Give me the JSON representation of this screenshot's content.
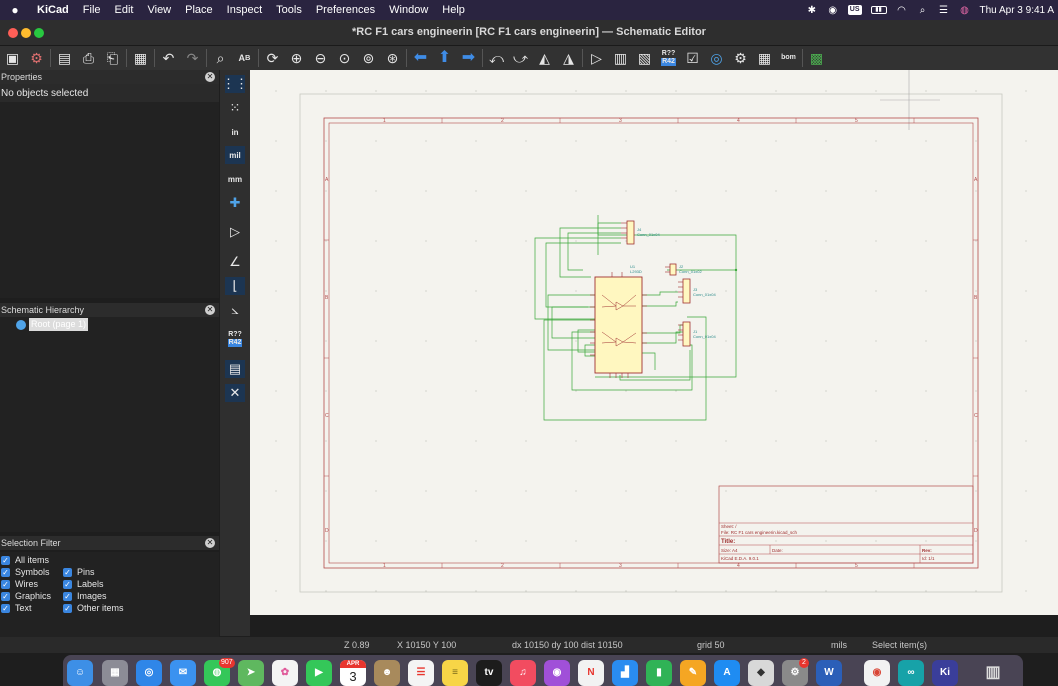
{
  "menubar": {
    "app_name": "KiCad",
    "items": [
      "File",
      "Edit",
      "View",
      "Place",
      "Inspect",
      "Tools",
      "Preferences",
      "Window",
      "Help"
    ],
    "input_badge": "US",
    "datetime": "Thu Apr 3  9:41 A"
  },
  "window": {
    "title": "*RC F1 cars engineerin [RC F1 cars engineerin] — Schematic Editor"
  },
  "properties_panel": {
    "header": "Properties",
    "selection": "No objects selected"
  },
  "hierarchy_panel": {
    "header": "Schematic Hierarchy",
    "root_label": "Root (page 1)"
  },
  "selection_filter": {
    "header": "Selection Filter",
    "items": [
      "All items",
      "Symbols",
      "Pins",
      "Wires",
      "Labels",
      "Graphics",
      "Images",
      "Text",
      "Other items"
    ]
  },
  "left_toolbar": {
    "unit_in": "in",
    "unit_mil": "mil",
    "unit_mm": "mm",
    "annotate_top": "R??",
    "annotate_bottom": "R42"
  },
  "toolbar": {
    "annotate_top": "R??",
    "annotate_bottom": "R42",
    "bom_label": "bom"
  },
  "schematic": {
    "frame_columns": [
      "1",
      "2",
      "3",
      "4",
      "5"
    ],
    "frame_rows": [
      "A",
      "B",
      "C",
      "D"
    ],
    "symbols": {
      "j4": {
        "ref": "J4",
        "value": "Conn_01x04"
      },
      "u1": {
        "ref": "U1",
        "value": "L293D"
      },
      "j2": {
        "ref": "J2",
        "value": "Conn_01x02"
      },
      "j3": {
        "ref": "J3",
        "value": "Conn_01x04"
      },
      "j1": {
        "ref": "J1",
        "value": "Conn_01x04"
      }
    },
    "title_block": {
      "sheet": "Sheet: /",
      "file": "File: RC F1 cars engineerin.kicad_sch",
      "title": "Title:",
      "size": "Size: A4",
      "date": "Date:",
      "rev": "Rev:",
      "version": "KiCad E.D.A. 9.0.1",
      "id": "Id: 1/1"
    }
  },
  "statusbar": {
    "zoom": "Z 0.89",
    "cursor": "X 10150  Y 100",
    "delta": "dx 10150  dy 100  dist 10150",
    "grid": "grid 50",
    "units": "mils",
    "mode": "Select item(s)"
  },
  "dock": {
    "messages_badge": "907",
    "calendar_month": "APR",
    "calendar_day": "3",
    "settings_badge": "2",
    "kicad_label": "Ki",
    "word_label": "W"
  }
}
